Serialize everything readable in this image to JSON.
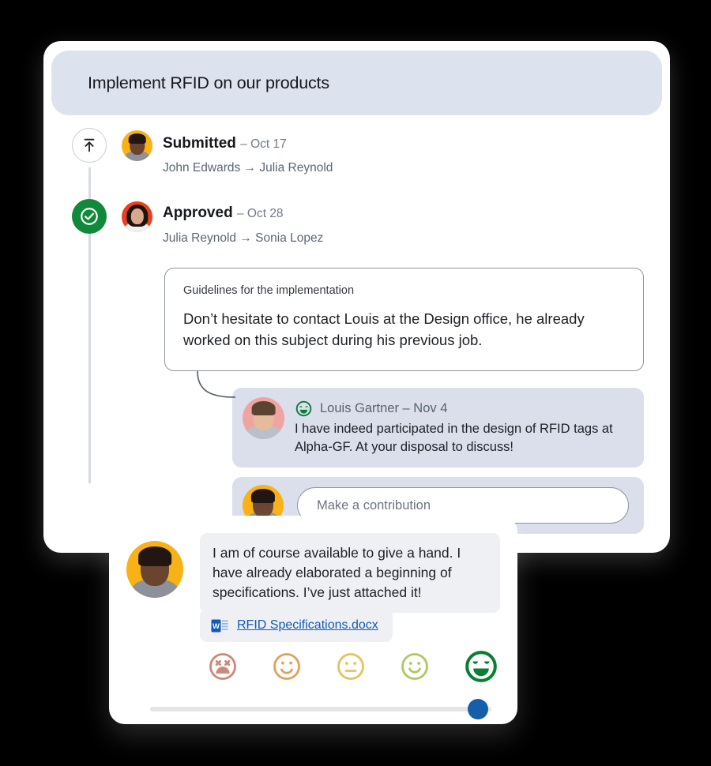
{
  "header": {
    "title": "Implement RFID on our products"
  },
  "timeline": [
    {
      "status": "Submitted",
      "date": "– Oct 17",
      "flow": "John Edwards → Julia Reynold",
      "icon": "upload-icon",
      "badge_style": "outline"
    },
    {
      "status": "Approved",
      "date": "– Oct 28",
      "flow": "Julia Reynold → Sonia Lopez",
      "icon": "check-circle-icon",
      "badge_style": "approved"
    }
  ],
  "note": {
    "label": "Guidelines for the implementation",
    "body": "Don’t hesitate to contact Louis at the Design office, he already worked on this subject during his previous job."
  },
  "reply": {
    "mood_icon": "smiley-very-happy-icon",
    "author": "Louis Gartner – Nov 4",
    "text": "I have indeed participated in the design of RFID tags at Alpha-GF. At your disposal to discuss!"
  },
  "composer": {
    "placeholder": "Make a contribution",
    "value": ""
  },
  "overlay": {
    "message": "I am of course available to give a hand. I have already elaborated a beginning of specifications. I’ve just attached it!",
    "attachment": {
      "icon": "word-document-icon",
      "name": "RFID Specifications.docx"
    },
    "rating": {
      "options": [
        {
          "name": "rating-very-bad",
          "face": "x-eyes-frown",
          "color": "#cf8878"
        },
        {
          "name": "rating-bad",
          "face": "frown",
          "color": "#e0a15c"
        },
        {
          "name": "rating-neutral",
          "face": "neutral",
          "color": "#e3c361"
        },
        {
          "name": "rating-good",
          "face": "smile",
          "color": "#aacb5f"
        },
        {
          "name": "rating-very-good",
          "face": "big-smile",
          "color": "#0a7f33"
        }
      ],
      "selected_index": 4
    },
    "slider": {
      "value_percent": 96
    }
  },
  "colors": {
    "header_bg": "#dde3ee",
    "bubble_bg": "#dadfeb",
    "approved_green": "#108a3a",
    "link_blue": "#1559b8",
    "slider_blue": "#155fa8"
  }
}
